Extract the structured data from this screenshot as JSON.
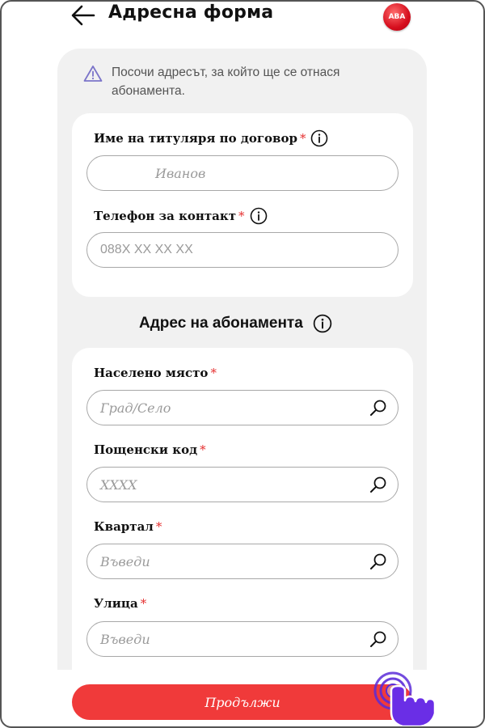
{
  "header": {
    "title": "Адресна форма",
    "logo_text": "ABA"
  },
  "notice": {
    "text": "Посочи адресът, за който ще се отнася абонамента."
  },
  "holder_card": {
    "name_label": "Име на титуляря по договор",
    "name_value": "Иванов",
    "phone_label": "Телефон за контакт",
    "phone_placeholder": "088X XX XX XX",
    "required_mark": "*"
  },
  "address_section": {
    "title": "Адрес на абонамента"
  },
  "address_card": {
    "fields": [
      {
        "label": "Населено място",
        "placeholder": "Град/Село"
      },
      {
        "label": "Пощенски код",
        "placeholder": "XXXX"
      },
      {
        "label": "Квартал",
        "placeholder": "Въведи"
      },
      {
        "label": "Улица",
        "placeholder": "Въведи"
      }
    ]
  },
  "footer": {
    "continue_label": "Продължи"
  },
  "colors": {
    "accent": "#f03a3a",
    "required": "#e53030",
    "warning_icon": "#7b74c9",
    "panel_bg": "#f1f1f1",
    "tap_indicator": "#5b2bd8"
  },
  "icons": {
    "back": "arrow-left-icon",
    "warning": "warning-triangle-icon",
    "info": "info-circle-icon",
    "search": "search-icon"
  }
}
